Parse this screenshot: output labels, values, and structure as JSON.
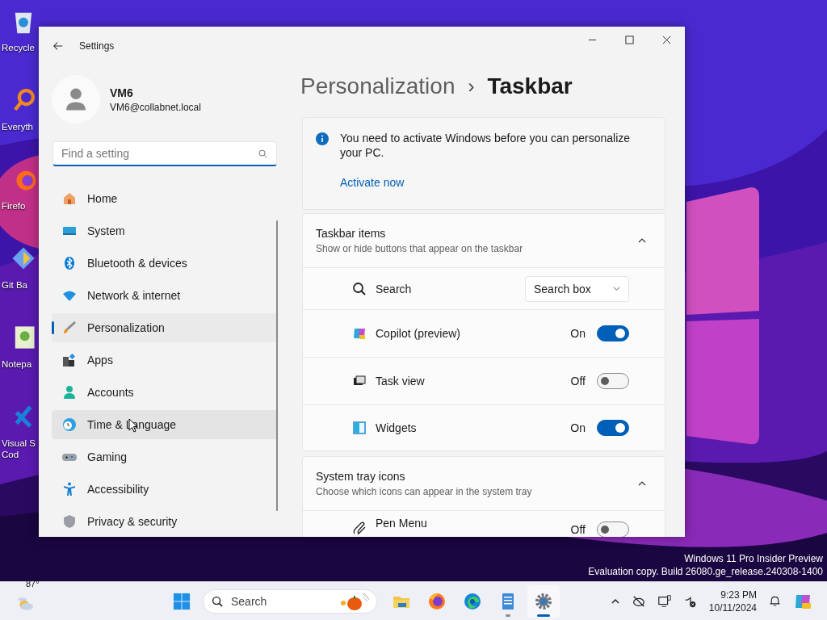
{
  "desktop": {
    "icons": [
      {
        "lines": [
          "Recycle"
        ]
      },
      {
        "lines": [
          "Everyth"
        ]
      },
      {
        "lines": [
          "Firefo"
        ]
      },
      {
        "lines": [
          "Git Ba"
        ]
      },
      {
        "lines": [
          "Notepa"
        ]
      },
      {
        "lines": [
          "Visual S",
          "Cod"
        ]
      }
    ],
    "watermark": [
      "Windows 11 Pro Insider Preview",
      "Evaluation copy. Build 26080.ge_release.240308-1400"
    ]
  },
  "window": {
    "title": "Settings"
  },
  "account": {
    "name": "VM6",
    "email": "VM6@collabnet.local"
  },
  "search": {
    "placeholder": "Find a setting"
  },
  "sidebar": {
    "items": [
      {
        "label": "Home",
        "selected": false,
        "hovered": false
      },
      {
        "label": "System",
        "selected": false,
        "hovered": false
      },
      {
        "label": "Bluetooth & devices",
        "selected": false,
        "hovered": false
      },
      {
        "label": "Network & internet",
        "selected": false,
        "hovered": false
      },
      {
        "label": "Personalization",
        "selected": true,
        "hovered": false
      },
      {
        "label": "Apps",
        "selected": false,
        "hovered": false
      },
      {
        "label": "Accounts",
        "selected": false,
        "hovered": false
      },
      {
        "label": "Time & Language",
        "selected": false,
        "hovered": true
      },
      {
        "label": "Gaming",
        "selected": false,
        "hovered": false
      },
      {
        "label": "Accessibility",
        "selected": false,
        "hovered": false
      },
      {
        "label": "Privacy & security",
        "selected": false,
        "hovered": false
      }
    ]
  },
  "breadcrumb": {
    "separator": "›",
    "items": [
      {
        "label": "Personalization",
        "selected": false
      },
      {
        "label": "Taskbar",
        "selected": true
      }
    ]
  },
  "notice": {
    "text": "You need to activate Windows before you can personalize your PC.",
    "link": "Activate now"
  },
  "sections": [
    {
      "title": "Taskbar items",
      "subtitle": "Show or hide buttons that appear on the taskbar",
      "expanded": true,
      "rows": [
        {
          "kind": "dropdown",
          "label": "Search",
          "value": "Search box"
        },
        {
          "kind": "toggle",
          "label": "Copilot (preview)",
          "state": "On",
          "on": true
        },
        {
          "kind": "toggle",
          "label": "Task view",
          "state": "Off",
          "on": false
        },
        {
          "kind": "toggle",
          "label": "Widgets",
          "state": "On",
          "on": true
        }
      ]
    },
    {
      "title": "System tray icons",
      "subtitle": "Choose which icons can appear in the system tray",
      "expanded": true,
      "rows": [
        {
          "kind": "toggle",
          "label": "Pen Menu",
          "state": "Off",
          "on": false
        }
      ]
    }
  ],
  "taskbar": {
    "weather": "87°",
    "search": {
      "placeholder": "Search"
    },
    "apps": [
      {
        "open": false,
        "active": false
      },
      {
        "open": false,
        "active": false
      },
      {
        "open": false,
        "active": false
      },
      {
        "open": true,
        "active": false
      },
      {
        "open": true,
        "active": true
      }
    ],
    "clock": {
      "time": "9:23 PM",
      "date": "10/11/2024"
    }
  }
}
